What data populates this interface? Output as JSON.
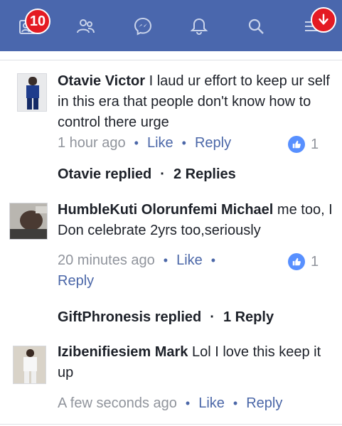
{
  "navbar": {
    "notification_count": "10",
    "icons": [
      "friend-requests-icon",
      "people-icon",
      "messenger-icon",
      "bell-icon",
      "search-icon",
      "menu-icon"
    ]
  },
  "comments": [
    {
      "author": "Otavie Victor",
      "text": "I laud ur effort to keep ur self in this era that people don't know how to control there urge",
      "time": "1 hour ago",
      "like_label": "Like",
      "reply_label": "Reply",
      "likes": "1",
      "replies_summary": {
        "who": "Otavie replied",
        "count": "2 Replies"
      }
    },
    {
      "author": "HumbleKuti Olorunfemi Michael",
      "text": "me too, I Don celebrate 2yrs too,seriously",
      "time": "20 minutes ago",
      "like_label": "Like",
      "reply_label": "Reply",
      "likes": "1",
      "replies_summary": {
        "who": "GiftPhronesis replied",
        "count": "1 Reply"
      }
    },
    {
      "author": "Izibenifiesiem Mark",
      "text": "Lol I love this keep it up",
      "time": "A few seconds ago",
      "like_label": "Like",
      "reply_label": "Reply"
    }
  ],
  "colors": {
    "navbar": "#4a67ad",
    "badge": "#e41b23",
    "link": "#4b67a8",
    "meta": "#90949c",
    "like_bubble": "#5890ff"
  }
}
